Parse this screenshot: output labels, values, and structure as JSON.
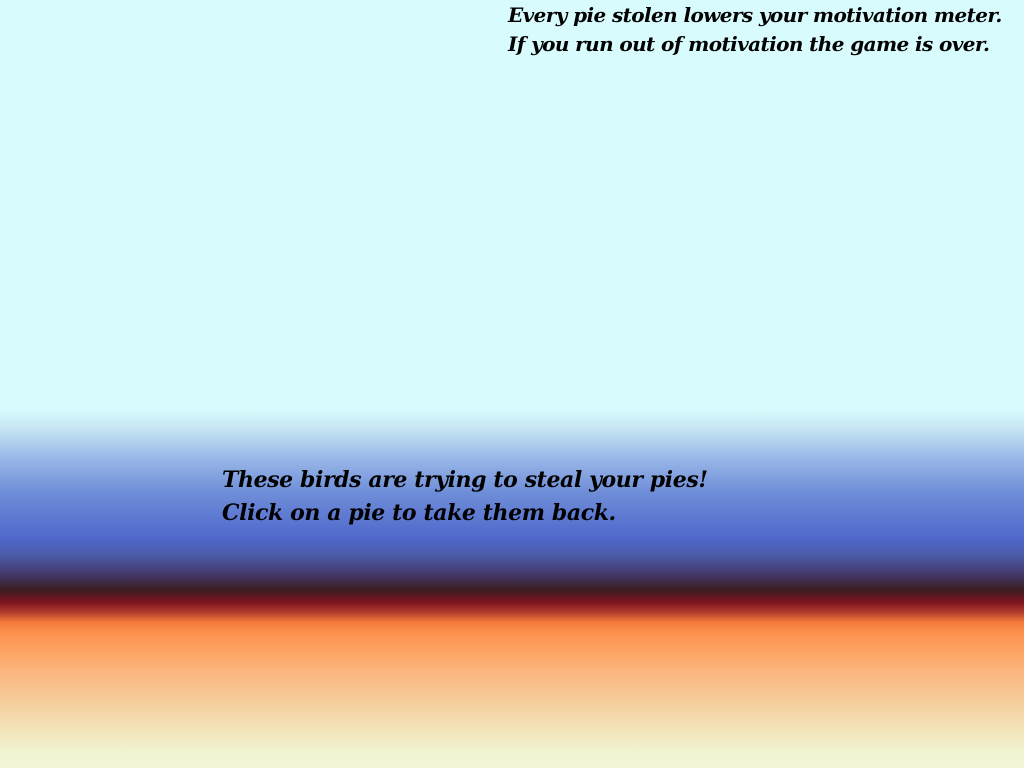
{
  "hint": {
    "line1": "Every pie stolen lowers your motivation meter.",
    "line2": "If you run out of motivation the game is over."
  },
  "intro": {
    "line1": "These birds are trying to steal your pies!",
    "line2": "Click on a pie to take them back."
  }
}
